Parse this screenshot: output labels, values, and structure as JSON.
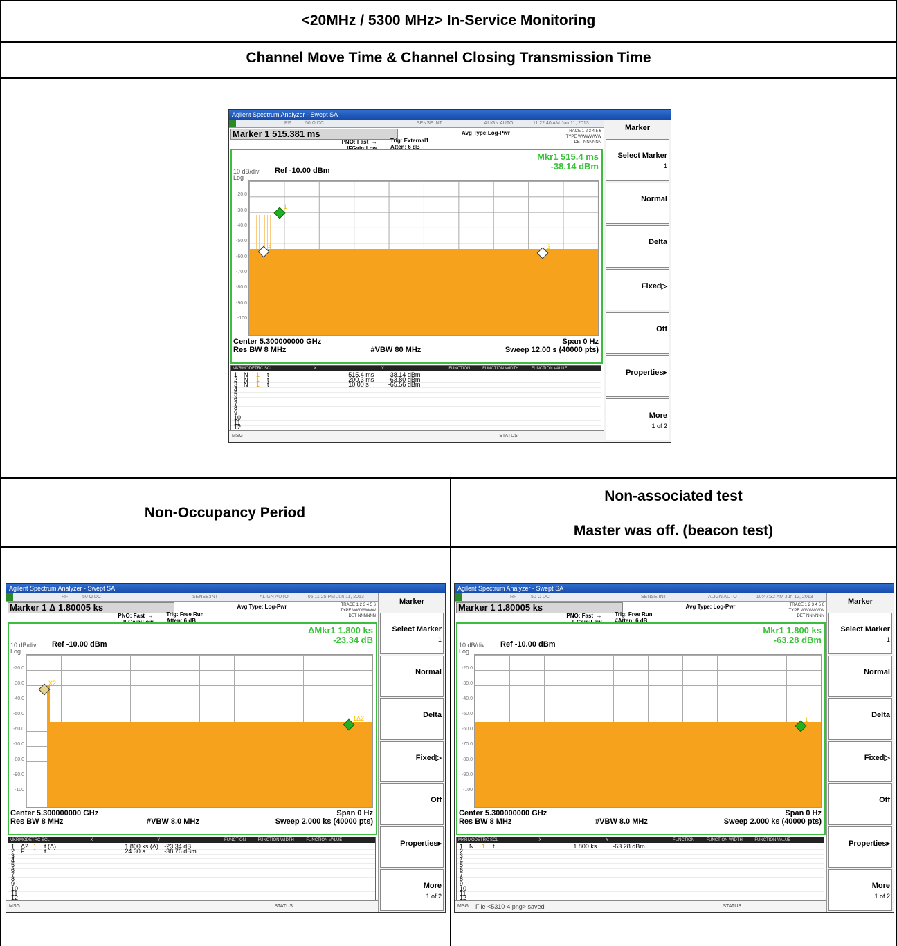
{
  "header": {
    "title": "<20MHz / 5300 MHz> In-Service Monitoring",
    "subtitle": "Channel Move Time & Channel Closing Transmission Time",
    "left_col": "Non-Occupancy Period",
    "right_col_line1": "Non-associated test",
    "right_col_line2": "Master was off. (beacon test)"
  },
  "analyzers": [
    {
      "window_title": "Agilent Spectrum Analyzer - Swept SA",
      "status_bar": {
        "rf": "RF",
        "imp": "50 Ω  DC",
        "sense": "SENSE:INT",
        "align": "ALIGN AUTO",
        "time": "11:22:40 AM Jun 11, 2013"
      },
      "marker_label": "Marker 1 515.381 ms",
      "pno": "PNO: Fast  →\nIFGain:Low",
      "trig": "Trig: External1\nAtten: 6 dB",
      "avg": "Avg Type:Log-Pwr",
      "trace": "TRACE 1 2 3 4 5 6\nTYPE WWWWWW\nDET NNNNNN",
      "readout1": "Mkr1 515.4 ms",
      "readout2": "-38.14 dBm",
      "dbdiv": "10 dB/div",
      "ref": "Ref -10.00 dBm",
      "log": "Log",
      "yticks": [
        "-20.0",
        "-30.0",
        "-40.0",
        "-50.0",
        "-60.0",
        "-70.0",
        "-80.0",
        "-90.0",
        "-100"
      ],
      "center": "Center 5.300000000 GHz",
      "resbw": "Res BW 8 MHz",
      "vbw": "#VBW 80 MHz",
      "span": "Span 0 Hz",
      "sweep": "Sweep  12.00 s (40000 pts)",
      "table_head": [
        "MKR",
        "MODE",
        "TRC",
        "SCL",
        "X",
        "Y",
        "FUNCTION",
        "FUNCTION WIDTH",
        "FUNCTION VALUE"
      ],
      "rows": [
        {
          "n": "1",
          "mode": "N",
          "trc": "1",
          "scl": "t",
          "x": "515.4 ms",
          "y": "-38.14 dBm"
        },
        {
          "n": "2",
          "mode": "N",
          "trc": "1",
          "scl": "t",
          "x": "200.3 ms",
          "y": "-63.80 dBm"
        },
        {
          "n": "3",
          "mode": "N",
          "trc": "1",
          "scl": "t",
          "x": "10.00 s",
          "y": "-65.56 dBm"
        },
        {
          "n": "4"
        },
        {
          "n": "5"
        },
        {
          "n": "6"
        },
        {
          "n": "7"
        },
        {
          "n": "8"
        },
        {
          "n": "9"
        },
        {
          "n": "10"
        },
        {
          "n": "11"
        },
        {
          "n": "12"
        }
      ],
      "msg": "MSG",
      "msg_text": "",
      "status": "STATUS",
      "softkeys": {
        "title": "Marker",
        "k1": "Select Marker",
        "k1sub": "1",
        "k2": "Normal",
        "k3": "Delta",
        "k4": "Fixed▷",
        "k5": "Off",
        "k6": "Properties▸",
        "k7": "More",
        "k7sub": "1 of 2"
      },
      "markers": [
        {
          "label": "1"
        },
        {
          "label": "2"
        },
        {
          "label": "3"
        }
      ]
    },
    {
      "window_title": "Agilent Spectrum Analyzer - Swept SA",
      "status_bar": {
        "rf": "RF",
        "imp": "50 Ω  DC",
        "sense": "SENSE:INT",
        "align": "ALIGN AUTO",
        "time": "05:11:25 PM Jun 11, 2013"
      },
      "marker_label": "Marker 1 Δ 1.80005 ks",
      "pno": "PNO: Fast  →\nIFGain:Low",
      "trig": "Trig: Free Run\nAtten: 6 dB",
      "avg": "Avg Type: Log-Pwr",
      "trace": "TRACE 1 2 3 4 5 6\nTYPE WWWWWW\nDET NNNNNN",
      "readout1": "ΔMkr1 1.800 ks",
      "readout2": "-23.34 dB",
      "dbdiv": "10 dB/div",
      "ref": "Ref -10.00 dBm",
      "log": "Log",
      "yticks": [
        "-20.0",
        "-30.0",
        "-40.0",
        "-50.0",
        "-60.0",
        "-70.0",
        "-80.0",
        "-90.0",
        "-100"
      ],
      "center": "Center 5.300000000 GHz",
      "resbw": "Res BW 8 MHz",
      "vbw": "#VBW 8.0 MHz",
      "span": "Span 0 Hz",
      "sweep": "Sweep  2.000 ks (40000 pts)",
      "table_head": [
        "MKR",
        "MODE",
        "TRC",
        "SCL",
        "X",
        "Y",
        "FUNCTION",
        "FUNCTION WIDTH",
        "FUNCTION VALUE"
      ],
      "rows": [
        {
          "n": "1",
          "mode": "Δ2",
          "trc": "1",
          "scl": "t (Δ)",
          "x": "1.800 ks (Δ)",
          "y": "-23.34 dB"
        },
        {
          "n": "2",
          "mode": "F",
          "trc": "1",
          "scl": "t",
          "x": "24.30 s",
          "y": "-38.76 dBm"
        },
        {
          "n": "3"
        },
        {
          "n": "4"
        },
        {
          "n": "5"
        },
        {
          "n": "6"
        },
        {
          "n": "7"
        },
        {
          "n": "8"
        },
        {
          "n": "9"
        },
        {
          "n": "10"
        },
        {
          "n": "11"
        },
        {
          "n": "12"
        }
      ],
      "msg": "MSG",
      "msg_text": "",
      "status": "STATUS",
      "softkeys": {
        "title": "Marker",
        "k1": "Select Marker",
        "k1sub": "1",
        "k2": "Normal",
        "k3": "Delta",
        "k4": "Fixed▷",
        "k5": "Off",
        "k6": "Properties▸",
        "k7": "More",
        "k7sub": "1 of 2"
      },
      "markers": [
        {
          "label": "X2"
        },
        {
          "label": "1Δ2"
        }
      ]
    },
    {
      "window_title": "Agilent Spectrum Analyzer - Swept SA",
      "status_bar": {
        "rf": "RF",
        "imp": "50 Ω  DC",
        "sense": "SENSE:INT",
        "align": "ALIGN AUTO",
        "time": "10:47:32 AM Jun 12, 2013"
      },
      "marker_label": "Marker 1 1.80005 ks",
      "pno": "PNO: Fast  →\nIFGain:Low",
      "trig": "Trig: Free Run\n#Atten: 6 dB",
      "avg": "Avg Type: Log-Pwr",
      "trace": "TRACE 1 2 3 4 5 6\nTYPE WWWWWW\nDET NNNNNN",
      "readout1": "Mkr1 1.800 ks",
      "readout2": "-63.28 dBm",
      "dbdiv": "10 dB/div",
      "ref": "Ref -10.00 dBm",
      "log": "Log",
      "yticks": [
        "-20.0",
        "-30.0",
        "-40.0",
        "-50.0",
        "-60.0",
        "-70.0",
        "-80.0",
        "-90.0",
        "-100"
      ],
      "center": "Center 5.300000000 GHz",
      "resbw": "Res BW 8 MHz",
      "vbw": "#VBW 8.0 MHz",
      "span": "Span 0 Hz",
      "sweep": "Sweep  2.000 ks (40000 pts)",
      "table_head": [
        "MKR",
        "MODE",
        "TRC",
        "SCL",
        "X",
        "Y",
        "FUNCTION",
        "FUNCTION WIDTH",
        "FUNCTION VALUE"
      ],
      "rows": [
        {
          "n": "1",
          "mode": "N",
          "trc": "1",
          "scl": "t",
          "x": "1.800 ks",
          "y": "-63.28 dBm"
        },
        {
          "n": "2"
        },
        {
          "n": "3"
        },
        {
          "n": "4"
        },
        {
          "n": "5"
        },
        {
          "n": "6"
        },
        {
          "n": "7"
        },
        {
          "n": "8"
        },
        {
          "n": "9"
        },
        {
          "n": "10"
        },
        {
          "n": "11"
        },
        {
          "n": "12"
        }
      ],
      "msg": "MSG",
      "msg_text": "File <5310-4.png> saved",
      "status": "STATUS",
      "softkeys": {
        "title": "Marker",
        "k1": "Select Marker",
        "k1sub": "1",
        "k2": "Normal",
        "k3": "Delta",
        "k4": "Fixed▷",
        "k5": "Off",
        "k6": "Properties▸",
        "k7": "More",
        "k7sub": "1 of 2"
      },
      "markers": [
        {
          "label": "1"
        }
      ]
    }
  ],
  "colors": {
    "trace": "#f7a21c",
    "screen_border": "#3dbd3d",
    "readout": "#3ac23a",
    "marker_green": "#22b022"
  }
}
